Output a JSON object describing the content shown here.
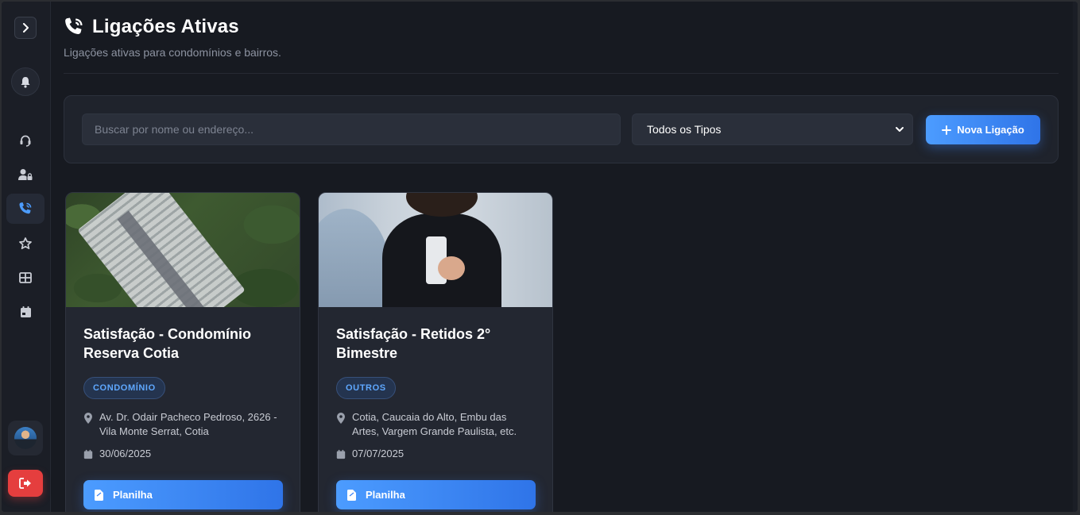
{
  "header": {
    "title": "Ligações Ativas",
    "subtitle": "Ligações ativas para condomínios e bairros."
  },
  "filters": {
    "search_placeholder": "Buscar por nome ou endereço...",
    "type_selected": "Todos os Tipos",
    "new_button_label": "Nova Ligação"
  },
  "sidebar": {
    "items": [
      {
        "icon": "headset-icon"
      },
      {
        "icon": "user-lock-icon"
      },
      {
        "icon": "phone-volume-icon",
        "active": true
      },
      {
        "icon": "star-icon"
      },
      {
        "icon": "table-icon"
      },
      {
        "icon": "calendar-icon"
      }
    ]
  },
  "cards": [
    {
      "title": "Satisfação - Condomínio Reserva Cotia",
      "badge": "CONDOMÍNIO",
      "address": "Av. Dr. Odair Pacheco Pedroso, 2626 - Vila Monte Serrat, Cotia",
      "date": "30/06/2025",
      "button_label": "Planilha"
    },
    {
      "title": "Satisfação - Retidos 2° Bimestre",
      "badge": "OUTROS",
      "address": "Cotia, Caucaia do Alto, Embu das Artes, Vargem Grande Paulista, etc.",
      "date": "07/07/2025",
      "button_label": "Planilha"
    }
  ],
  "colors": {
    "accent": "#3b82f6",
    "danger": "#e53e3e",
    "background": "#171a21"
  }
}
